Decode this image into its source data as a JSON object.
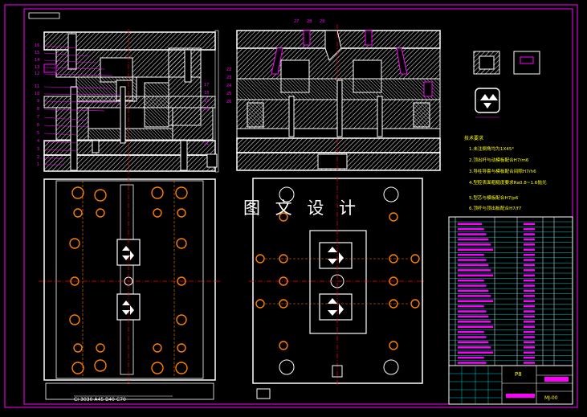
{
  "watermark": "图 文 设 计",
  "plan_caption": "CI-3030-A45-B40-C70",
  "notes": {
    "title": "技术要求",
    "items": [
      "1.未注倒角均为1X45°",
      "2.顶出杆与动模板配合H7/m6",
      "3.导柱导套与模板配合间隙H7/h6",
      "4.型腔表面粗糙度要求Ra0.8~1.6抛光",
      "5.型芯与模板配合H7/p6",
      "6.顶杆与顶出板配合H7/f7"
    ]
  },
  "title_block": {
    "scale": "P8",
    "drawing_no": "MJ-00"
  },
  "part_numbers_left": [
    "16",
    "15",
    "14",
    "13",
    "12",
    "11",
    "10",
    "9",
    "8",
    "7",
    "6",
    "5",
    "4",
    "3",
    "2",
    "1"
  ],
  "part_numbers_right": [
    "17",
    "18",
    "19",
    "20",
    "21"
  ],
  "part_numbers_top": [
    "27",
    "28",
    "29"
  ],
  "part_numbers_mid": [
    "22",
    "23",
    "24",
    "25",
    "26"
  ],
  "colors": {
    "background": "#000000",
    "outline": "#ffffff",
    "hatch": "#ffffff",
    "annotation": "#ff00ff",
    "centerline": "#ff0000",
    "note_text": "#ffff00",
    "bolt": "#ff7f00",
    "table_line": "#00ffff",
    "frame": "#ff00ff"
  }
}
